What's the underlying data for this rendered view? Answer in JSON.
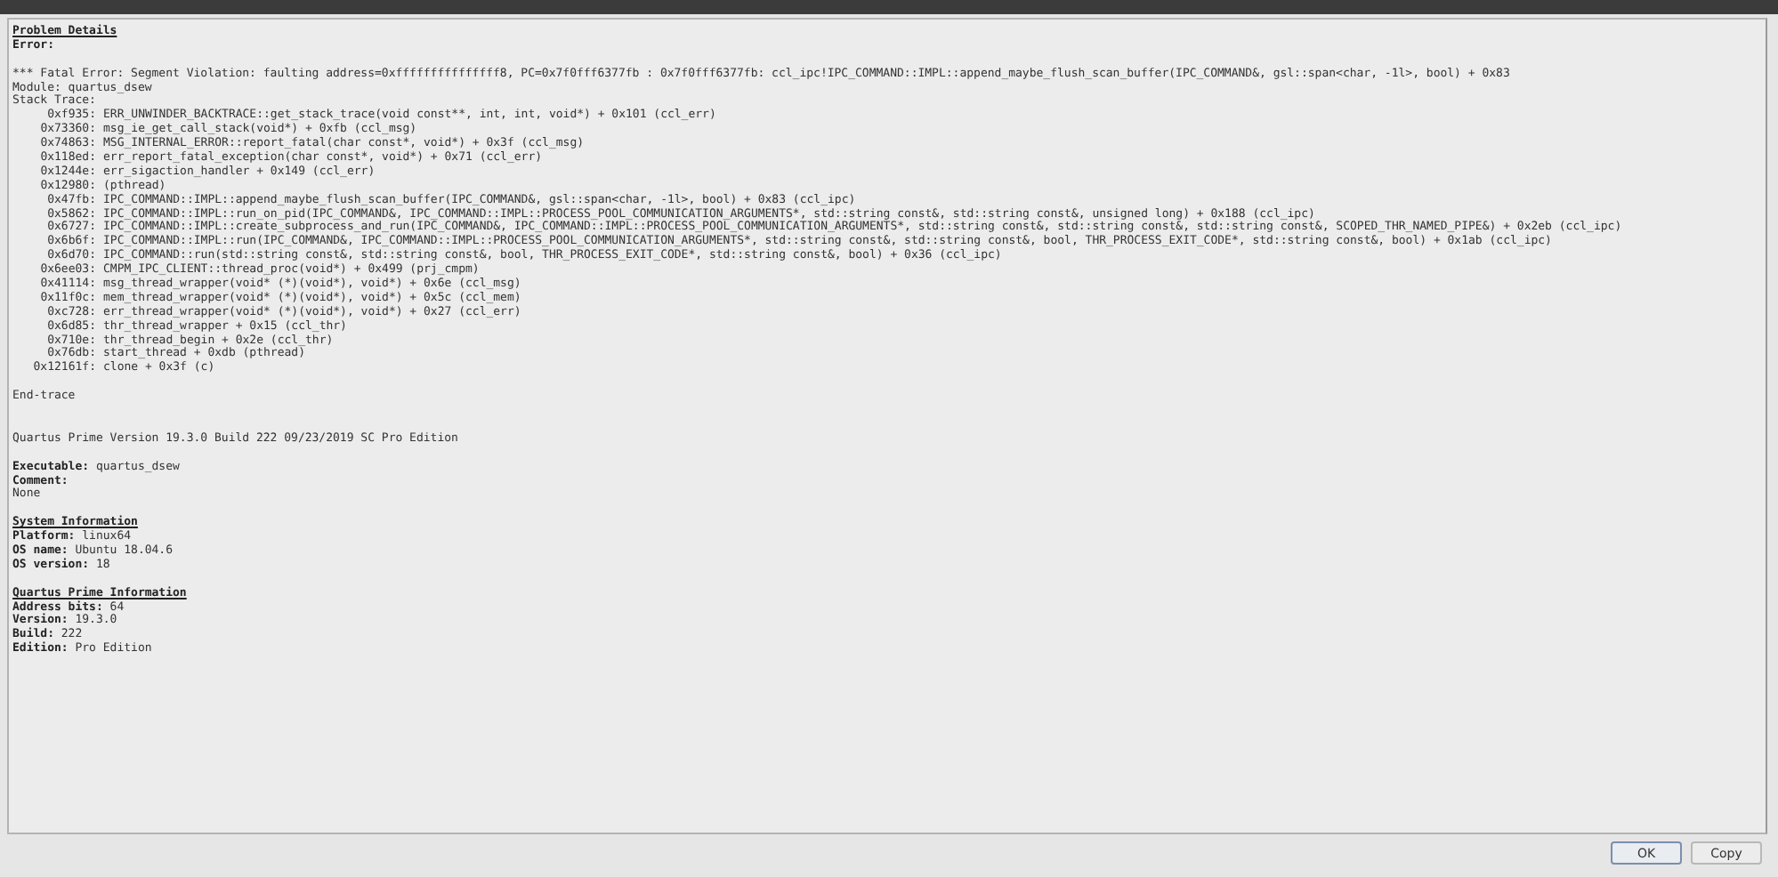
{
  "details": {
    "lines": [
      {
        "kind": "heading",
        "text": "Problem Details"
      },
      {
        "kind": "label",
        "text": "Error:"
      },
      {
        "kind": "blank"
      },
      {
        "kind": "text",
        "text": "*** Fatal Error: Segment Violation: faulting address=0xfffffffffffffff8, PC=0x7f0fff6377fb : 0x7f0fff6377fb: ccl_ipc!IPC_COMMAND::IMPL::append_maybe_flush_scan_buffer(IPC_COMMAND&, gsl::span<char, -1l>, bool) + 0x83"
      },
      {
        "kind": "text",
        "text": "Module: quartus_dsew"
      },
      {
        "kind": "text",
        "text": "Stack Trace:"
      },
      {
        "kind": "frame",
        "address": "0xf935:",
        "call": "ERR_UNWINDER_BACKTRACE::get_stack_trace(void const**, int, int, void*) + 0x101 (ccl_err)"
      },
      {
        "kind": "frame",
        "address": "0x73360:",
        "call": "msg_ie_get_call_stack(void*) + 0xfb (ccl_msg)"
      },
      {
        "kind": "frame",
        "address": "0x74863:",
        "call": "MSG_INTERNAL_ERROR::report_fatal(char const*, void*) + 0x3f (ccl_msg)"
      },
      {
        "kind": "frame",
        "address": "0x118ed:",
        "call": "err_report_fatal_exception(char const*, void*) + 0x71 (ccl_err)"
      },
      {
        "kind": "frame",
        "address": "0x1244e:",
        "call": "err_sigaction_handler + 0x149 (ccl_err)"
      },
      {
        "kind": "frame",
        "address": "0x12980:",
        "call": "(pthread)"
      },
      {
        "kind": "frame",
        "address": "0x47fb:",
        "call": "IPC_COMMAND::IMPL::append_maybe_flush_scan_buffer(IPC_COMMAND&, gsl::span<char, -1l>, bool) + 0x83 (ccl_ipc)"
      },
      {
        "kind": "frame",
        "address": "0x5862:",
        "call": "IPC_COMMAND::IMPL::run_on_pid(IPC_COMMAND&, IPC_COMMAND::IMPL::PROCESS_POOL_COMMUNICATION_ARGUMENTS*, std::string const&, std::string const&, unsigned long) + 0x188 (ccl_ipc)"
      },
      {
        "kind": "frame",
        "address": "0x6727:",
        "call": "IPC_COMMAND::IMPL::create_subprocess_and_run(IPC_COMMAND&, IPC_COMMAND::IMPL::PROCESS_POOL_COMMUNICATION_ARGUMENTS*, std::string const&, std::string const&, std::string const&, SCOPED_THR_NAMED_PIPE&) + 0x2eb (ccl_ipc)"
      },
      {
        "kind": "frame",
        "address": "0x6b6f:",
        "call": "IPC_COMMAND::IMPL::run(IPC_COMMAND&, IPC_COMMAND::IMPL::PROCESS_POOL_COMMUNICATION_ARGUMENTS*, std::string const&, std::string const&, bool, THR_PROCESS_EXIT_CODE*, std::string const&, bool) + 0x1ab (ccl_ipc)"
      },
      {
        "kind": "frame",
        "address": "0x6d70:",
        "call": "IPC_COMMAND::run(std::string const&, std::string const&, bool, THR_PROCESS_EXIT_CODE*, std::string const&, bool) + 0x36 (ccl_ipc)"
      },
      {
        "kind": "frame",
        "address": "0x6ee03:",
        "call": "CMPM_IPC_CLIENT::thread_proc(void*) + 0x499 (prj_cmpm)"
      },
      {
        "kind": "frame",
        "address": "0x41114:",
        "call": "msg_thread_wrapper(void* (*)(void*), void*) + 0x6e (ccl_msg)"
      },
      {
        "kind": "frame",
        "address": "0x11f0c:",
        "call": "mem_thread_wrapper(void* (*)(void*), void*) + 0x5c (ccl_mem)"
      },
      {
        "kind": "frame",
        "address": "0xc728:",
        "call": "err_thread_wrapper(void* (*)(void*), void*) + 0x27 (ccl_err)"
      },
      {
        "kind": "frame",
        "address": "0x6d85:",
        "call": "thr_thread_wrapper + 0x15 (ccl_thr)"
      },
      {
        "kind": "frame",
        "address": "0x710e:",
        "call": "thr_thread_begin + 0x2e (ccl_thr)"
      },
      {
        "kind": "frame",
        "address": "0x76db:",
        "call": "start_thread + 0xdb (pthread)"
      },
      {
        "kind": "frame",
        "address": "0x12161f:",
        "call": "clone + 0x3f (c)"
      },
      {
        "kind": "blank"
      },
      {
        "kind": "text",
        "text": "End-trace"
      },
      {
        "kind": "blank"
      },
      {
        "kind": "blank"
      },
      {
        "kind": "text",
        "text": "Quartus Prime Version 19.3.0 Build 222 09/23/2019 SC Pro Edition"
      },
      {
        "kind": "blank"
      },
      {
        "kind": "text",
        "text": "**Executable:** quartus_dsew"
      },
      {
        "kind": "label",
        "text": "Comment:"
      },
      {
        "kind": "text",
        "text": "None"
      },
      {
        "kind": "blank"
      },
      {
        "kind": "heading",
        "text": "System Information"
      },
      {
        "kind": "text",
        "text": "**Platform:** linux64"
      },
      {
        "kind": "text",
        "text": "**OS name:** Ubuntu 18.04.6"
      },
      {
        "kind": "text",
        "text": "**OS version:** 18"
      },
      {
        "kind": "blank"
      },
      {
        "kind": "heading",
        "text": "Quartus Prime Information"
      },
      {
        "kind": "text",
        "text": "**Address bits:** 64"
      },
      {
        "kind": "text",
        "text": "**Version:** 19.3.0"
      },
      {
        "kind": "text",
        "text": "**Build:** 222"
      },
      {
        "kind": "text",
        "text": "**Edition:** Pro Edition"
      }
    ]
  },
  "buttons": [
    {
      "label": "OK",
      "default": true
    },
    {
      "label": "Copy",
      "default": false
    }
  ]
}
